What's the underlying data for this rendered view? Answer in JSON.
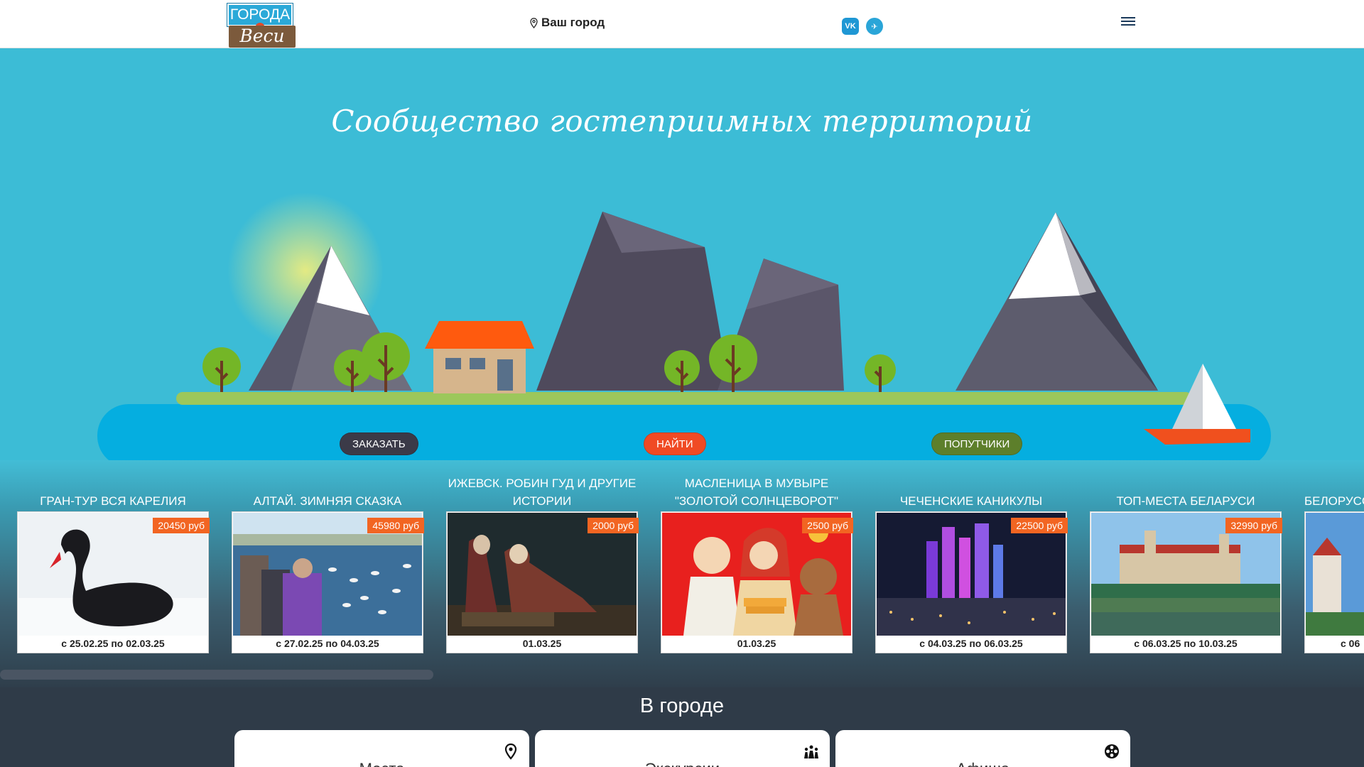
{
  "header": {
    "logo_top": "ГОРОДА",
    "logo_bottom": "Веси",
    "city_label": "Ваш город",
    "social": [
      {
        "icon": "vk-icon",
        "glyph": "VK"
      },
      {
        "icon": "telegram-icon",
        "glyph": "✈"
      }
    ]
  },
  "hero": {
    "title": "Сообщество гостеприимных территорий",
    "buttons": {
      "order": "ЗАКАЗАТЬ",
      "find": "НАЙТИ",
      "fellow": "ПОПУТЧИКИ"
    }
  },
  "tours": [
    {
      "title": "ГРАН-ТУР ВСЯ КАРЕЛИЯ",
      "price": "20450 руб",
      "date": "с 25.02.25 по 02.03.25",
      "image": "black-swan"
    },
    {
      "title": "АЛТАЙ. ЗИМНЯЯ СКАЗКА",
      "price": "45980 руб",
      "date": "с 27.02.25 по 04.03.25",
      "image": "swans-lake"
    },
    {
      "title": "ИЖЕВСК. РОБИН ГУД И ДРУГИЕ ИСТОРИИ",
      "price": "2000 руб",
      "date": "01.03.25",
      "image": "theatre"
    },
    {
      "title": "МАСЛЕНИЦА В МУВЫРЕ \"ЗОЛОТОЙ СОЛНЦЕВОРОТ\"",
      "price": "2500 руб",
      "date": "01.03.25",
      "image": "maslenitsa"
    },
    {
      "title": "ЧЕЧЕНСКИЕ КАНИКУЛЫ",
      "price": "22500 руб",
      "date": "с 04.03.25 по 06.03.25",
      "image": "grozny-night"
    },
    {
      "title": "ТОП-МЕСТА БЕЛАРУСИ",
      "price": "32990 руб",
      "date": "с 06.03.25 по 10.03.25",
      "image": "castle"
    },
    {
      "title": "БЕЛОРУССКИЕ",
      "price": "",
      "date": "с 06",
      "image": "mir-castle"
    }
  ],
  "in_city": {
    "title": "В городе",
    "tiles": [
      {
        "label": "Места",
        "icon": "location-pin-icon"
      },
      {
        "label": "Экскурсии",
        "icon": "people-icon"
      },
      {
        "label": "Афиша",
        "icon": "film-reel-icon"
      }
    ]
  },
  "colors": {
    "sky": "#3cbcd6",
    "water": "#05aee0",
    "accent_orange": "#f26522",
    "dark_section": "#2f3b48"
  }
}
